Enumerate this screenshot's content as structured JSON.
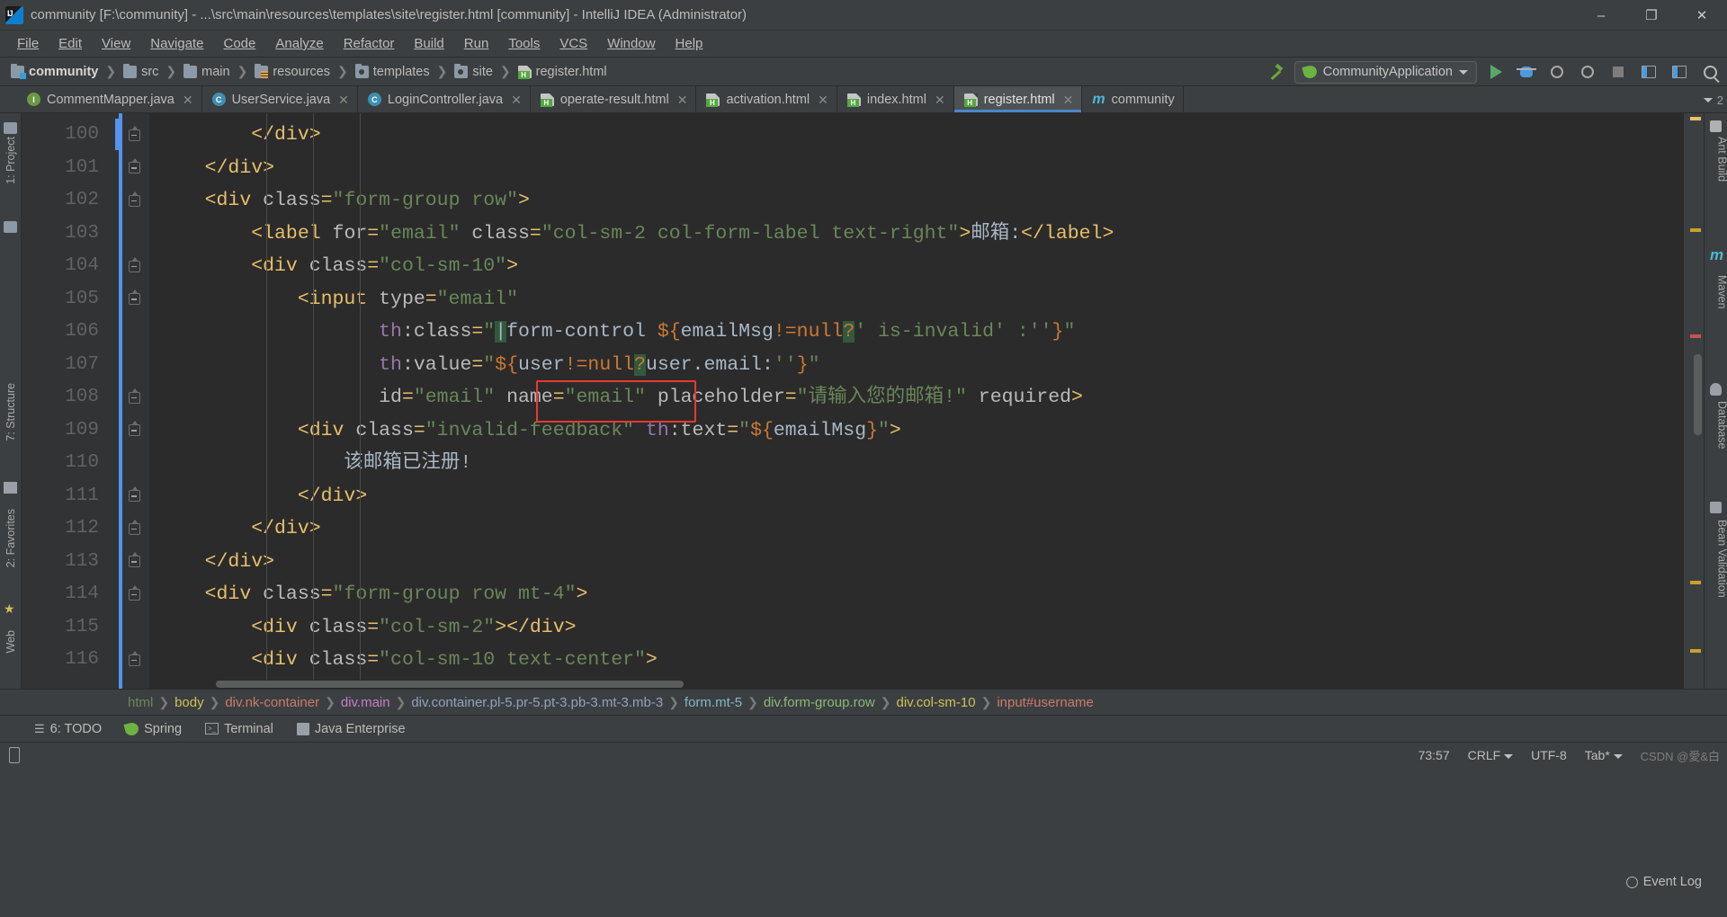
{
  "window": {
    "title": "community [F:\\community] - ...\\src\\main\\resources\\templates\\site\\register.html [community] - IntelliJ IDEA (Administrator)",
    "app_icon": "intellij-idea-icon",
    "minimize": "–",
    "maximize": "❐",
    "close": "✕"
  },
  "menubar": {
    "items": [
      {
        "label": "File"
      },
      {
        "label": "Edit"
      },
      {
        "label": "View"
      },
      {
        "label": "Navigate"
      },
      {
        "label": "Code"
      },
      {
        "label": "Analyze"
      },
      {
        "label": "Refactor"
      },
      {
        "label": "Build"
      },
      {
        "label": "Run"
      },
      {
        "label": "Tools"
      },
      {
        "label": "VCS"
      },
      {
        "label": "Window"
      },
      {
        "label": "Help"
      }
    ]
  },
  "navbar": {
    "crumbs": [
      {
        "label": "community",
        "icon": "module-folder-icon"
      },
      {
        "label": "src",
        "icon": "folder-icon"
      },
      {
        "label": "main",
        "icon": "folder-icon"
      },
      {
        "label": "resources",
        "icon": "resources-folder-icon"
      },
      {
        "label": "templates",
        "icon": "package-folder-icon"
      },
      {
        "label": "site",
        "icon": "package-folder-icon"
      },
      {
        "label": "register.html",
        "icon": "html-file-icon"
      }
    ],
    "separator": "❯",
    "run_config": "CommunityApplication",
    "toolbar_icons": [
      "build-hammer-icon",
      "run-icon",
      "debug-icon",
      "run-with-coverage-icon",
      "profiler-icon",
      "stop-icon",
      "layout-icon",
      "update-icon",
      "search-everywhere-icon"
    ]
  },
  "tabs": {
    "items": [
      {
        "label": "CommentMapper.java",
        "icon": "java-interface-icon",
        "active": false,
        "close": "✕"
      },
      {
        "label": "UserService.java",
        "icon": "java-class-icon",
        "active": false,
        "close": "✕"
      },
      {
        "label": "LoginController.java",
        "icon": "java-class-icon",
        "active": false,
        "close": "✕"
      },
      {
        "label": "operate-result.html",
        "icon": "html-file-icon",
        "active": false,
        "close": "✕"
      },
      {
        "label": "activation.html",
        "icon": "html-file-icon",
        "active": false,
        "close": "✕"
      },
      {
        "label": "index.html",
        "icon": "html-file-icon",
        "active": false,
        "close": "✕"
      },
      {
        "label": "register.html",
        "icon": "html-file-icon",
        "active": true,
        "close": "✕"
      },
      {
        "label": "community",
        "icon": "maven-module-icon",
        "active": false,
        "close": ""
      }
    ],
    "overflow_count": "2"
  },
  "editor": {
    "line_numbers": [
      "100",
      "101",
      "102",
      "103",
      "104",
      "105",
      "106",
      "107",
      "108",
      "109",
      "110",
      "111",
      "112",
      "113",
      "114",
      "115",
      "116"
    ],
    "lines": [
      "        </div>",
      "    </div>",
      "    <div class=\"form-group row\">",
      "        <label for=\"email\" class=\"col-sm-2 col-form-label text-right\">邮箱:</label>",
      "        <div class=\"col-sm-10\">",
      "            <input type=\"email\"",
      "                   th:class=\"form-control ${emailMsg!=null?' is-invalid' :''}\"",
      "                   th:value=\"${user!=null?user.email:''}\"",
      "                   id=\"email\" name=\"email\" placeholder=\"请输入您的邮箱!\" required>",
      "            <div class=\"invalid-feedback\" th:text=\"${emailMsg}\">",
      "                该邮箱已注册!",
      "            </div>",
      "        </div>",
      "    </div>",
      "    <div class=\"form-group row mt-4\">",
      "        <div class=\"col-sm-2\"></div>",
      "        <div class=\"col-sm-10 text-center\">"
    ],
    "annotation": {
      "shape": "red-rectangle",
      "target": "name=\"email\""
    }
  },
  "breadcrumb": {
    "items": [
      {
        "label": "html",
        "color": "#6a8759"
      },
      {
        "label": "body",
        "color": "#cfc05a"
      },
      {
        "label": "div.nk-container",
        "color": "#cc7a6a"
      },
      {
        "label": "div.main",
        "color": "#c77ccc"
      },
      {
        "label": "div.container.pl-5.pr-5.pt-3.pb-3.mt-3.mb-3",
        "color": "#8fa3c0"
      },
      {
        "label": "form.mt-5",
        "color": "#7fb8c9"
      },
      {
        "label": "div.form-group.row",
        "color": "#8aba73"
      },
      {
        "label": "div.col-sm-10",
        "color": "#cfc05a"
      },
      {
        "label": "input#username",
        "color": "#cc7a6a"
      }
    ],
    "separator": "❯"
  },
  "toolwindows": {
    "items": [
      {
        "label": "6: TODO",
        "icon": "todo-list-icon",
        "mnemonic": "6"
      },
      {
        "label": "Spring",
        "icon": "spring-leaf-icon"
      },
      {
        "label": "Terminal",
        "icon": "terminal-icon"
      },
      {
        "label": "Java Enterprise",
        "icon": "java-enterprise-icon"
      }
    ]
  },
  "left_strip": {
    "items": [
      {
        "label": "1: Project",
        "icon": "project-icon"
      },
      {
        "label": "7: Structure",
        "icon": "structure-icon"
      },
      {
        "label": "2: Favorites",
        "icon": "favorites-star-icon"
      },
      {
        "label": "Web",
        "icon": "web-icon"
      }
    ]
  },
  "right_strip": {
    "items": [
      {
        "label": "Ant Build",
        "icon": "ant-icon"
      },
      {
        "label": "m",
        "icon": "maven-icon"
      },
      {
        "label": "Maven",
        "icon": "maven-icon"
      },
      {
        "label": "Database",
        "icon": "database-icon"
      },
      {
        "label": "Bean Validation",
        "icon": "bean-validation-icon"
      }
    ]
  },
  "statusbar": {
    "event_log": "Event Log",
    "caret_position": "73:57",
    "line_separator": "CRLF",
    "encoding": "UTF-8",
    "indent": "Tab*",
    "watermark": "CSDN @愛&白",
    "memory_icon": "phone-icon"
  }
}
